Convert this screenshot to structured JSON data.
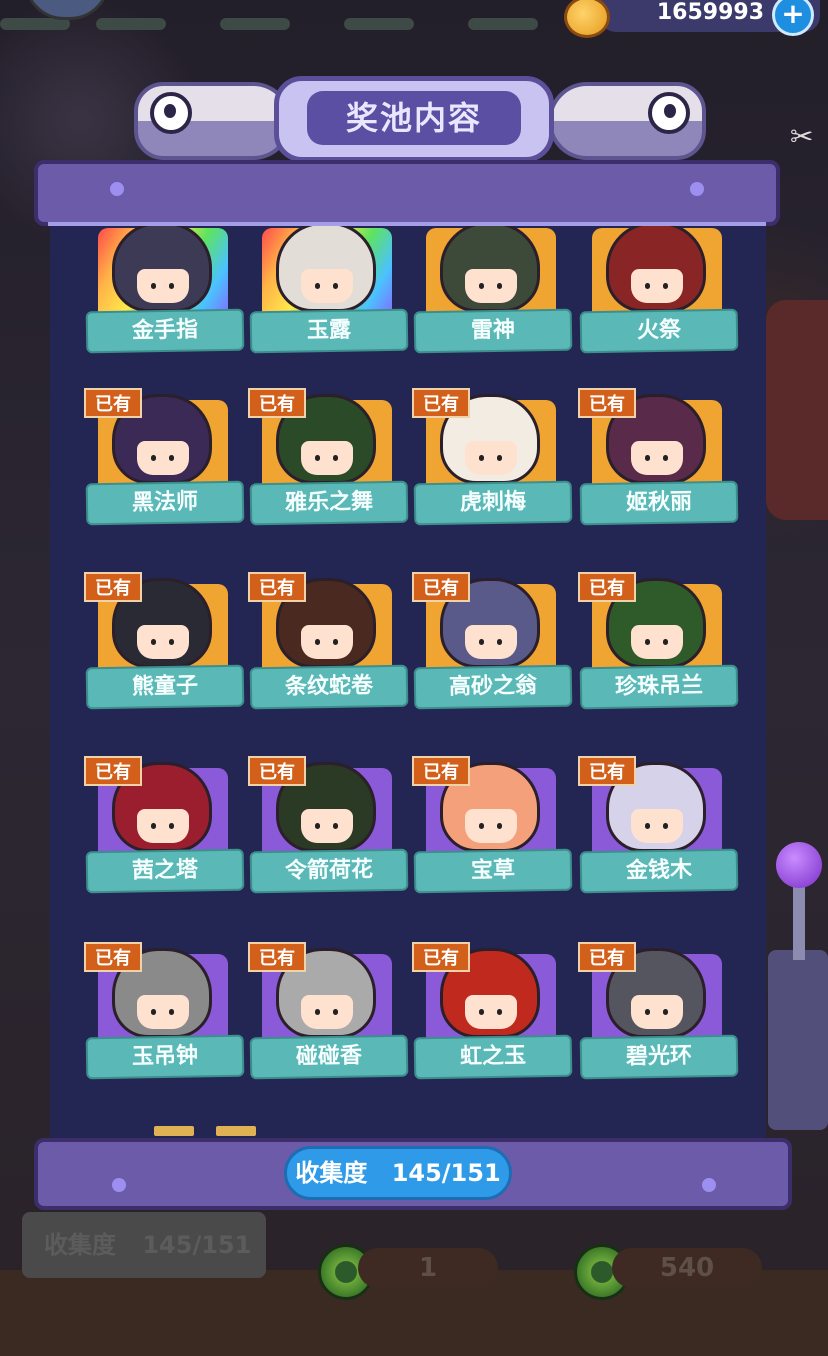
{
  "currency": {
    "amount": "1659993",
    "icon": "gold-coin-icon",
    "plus_icon": "plus-icon"
  },
  "header": {
    "title": "奖池内容"
  },
  "collection": {
    "label": "收集度",
    "value": "145/151"
  },
  "bottom": {
    "label": "收集度",
    "value": "145/151",
    "token_count": "1",
    "token_count2": "540"
  },
  "owned_label": "已有",
  "grid": [
    {
      "name": "金手指",
      "tile": "rainbow",
      "owned": true,
      "hair": "#3c3a55"
    },
    {
      "name": "玉露",
      "tile": "rainbow",
      "owned": true,
      "hair": "#e2ddd6"
    },
    {
      "name": "雷神",
      "tile": "gold",
      "owned": true,
      "hair": "#3d4a3a"
    },
    {
      "name": "火祭",
      "tile": "gold",
      "owned": true,
      "hair": "#8a2525"
    },
    {
      "name": "黑法师",
      "tile": "gold",
      "owned": true,
      "hair": "#3a2a55"
    },
    {
      "name": "雅乐之舞",
      "tile": "gold",
      "owned": true,
      "hair": "#2a4a28"
    },
    {
      "name": "虎刺梅",
      "tile": "gold",
      "owned": true,
      "hair": "#f2ece2"
    },
    {
      "name": "姬秋丽",
      "tile": "gold",
      "owned": true,
      "hair": "#5a2a4a"
    },
    {
      "name": "熊童子",
      "tile": "gold",
      "owned": true,
      "hair": "#2a2a35"
    },
    {
      "name": "条纹蛇卷",
      "tile": "gold",
      "owned": true,
      "hair": "#4a2a20"
    },
    {
      "name": "高砂之翁",
      "tile": "gold",
      "owned": true,
      "hair": "#5a5a8a"
    },
    {
      "name": "珍珠吊兰",
      "tile": "gold",
      "owned": true,
      "hair": "#2f5a2a"
    },
    {
      "name": "茜之塔",
      "tile": "purple",
      "owned": true,
      "hair": "#9a1e2e"
    },
    {
      "name": "令箭荷花",
      "tile": "purple",
      "owned": true,
      "hair": "#2a3a24"
    },
    {
      "name": "宝草",
      "tile": "purple",
      "owned": true,
      "hair": "#f4a07a"
    },
    {
      "name": "金钱木",
      "tile": "purple",
      "owned": true,
      "hair": "#d6d2ea"
    },
    {
      "name": "玉吊钟",
      "tile": "purple",
      "owned": true,
      "hair": "#8a8a8a"
    },
    {
      "name": "碰碰香",
      "tile": "purple",
      "owned": true,
      "hair": "#aaaaaa"
    },
    {
      "name": "虹之玉",
      "tile": "purple",
      "owned": true,
      "hair": "#c02a1e"
    },
    {
      "name": "碧光环",
      "tile": "purple",
      "owned": true,
      "hair": "#555560"
    }
  ]
}
